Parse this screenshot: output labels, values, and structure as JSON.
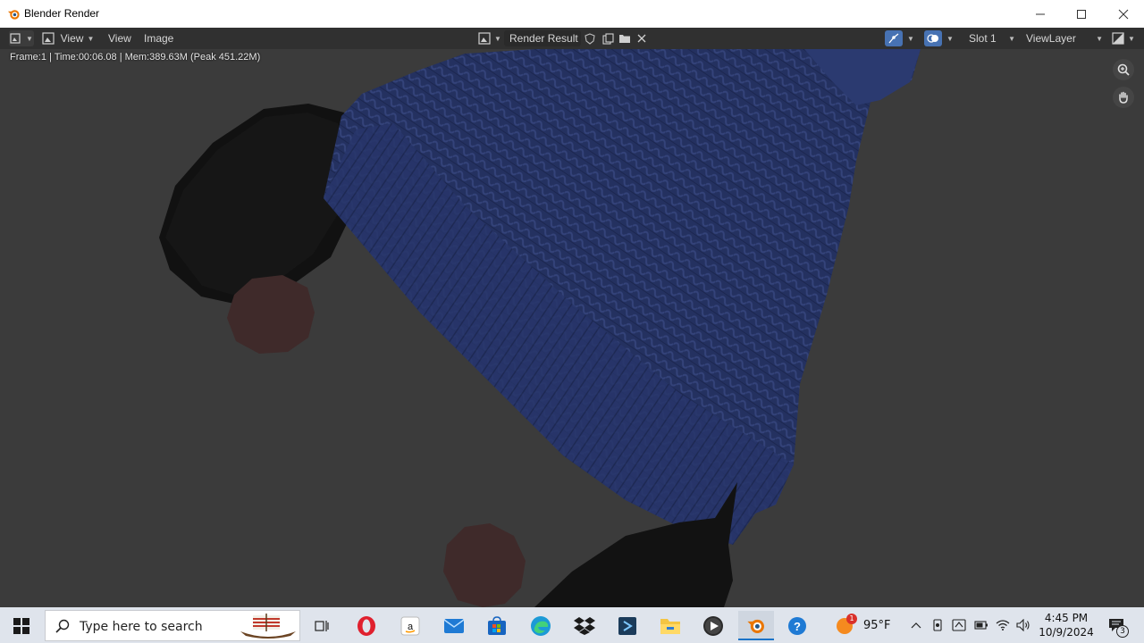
{
  "window": {
    "title": "Blender Render"
  },
  "header": {
    "view_menu_1": "View",
    "view_menu_2": "View",
    "image_menu": "Image",
    "image_name": "Render Result",
    "slot": "Slot 1",
    "view_layer": "ViewLayer"
  },
  "viewport": {
    "render_info": "Frame:1 | Time:00:06.08 | Mem:389.63M (Peak 451.22M)"
  },
  "taskbar": {
    "search_placeholder": "Type here to search",
    "apps": [
      "task-view",
      "opera",
      "amazon",
      "mail",
      "microsoft-store",
      "edge",
      "dropbox",
      "app-blue-s",
      "file-explorer",
      "media-player",
      "blender",
      "help"
    ],
    "weather_temp": "95°F",
    "weather_badge": "1",
    "time": "4:45 PM",
    "date": "10/9/2024",
    "notification_count": "3"
  },
  "colors": {
    "hat": "#23305f",
    "pompom": "#3f2a2a",
    "background": "#3b3b3b",
    "header": "#303030",
    "taskbar": "#dfe4ec"
  }
}
